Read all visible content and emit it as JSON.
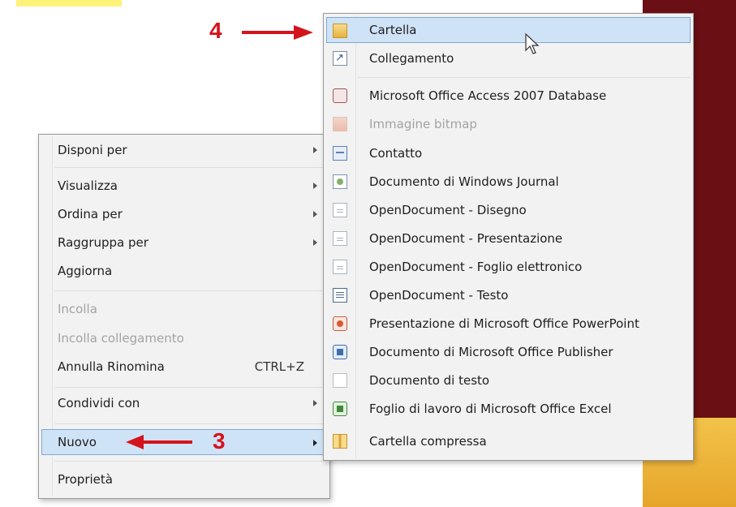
{
  "context_menu": {
    "items": [
      {
        "label": "Disponi per",
        "submenu": true
      },
      {
        "label": "Visualizza",
        "submenu": true
      },
      {
        "label": "Ordina per",
        "submenu": true
      },
      {
        "label": "Raggruppa per",
        "submenu": true
      },
      {
        "label": "Aggiorna"
      },
      {
        "label": "Incolla",
        "disabled": true
      },
      {
        "label": "Incolla collegamento",
        "disabled": true
      },
      {
        "label": "Annulla Rinomina",
        "shortcut": "CTRL+Z"
      },
      {
        "label": "Condividi con",
        "submenu": true
      },
      {
        "label": "Nuovo",
        "submenu": true,
        "highlighted": true
      },
      {
        "label": "Proprietà"
      }
    ]
  },
  "new_submenu": {
    "items": [
      {
        "label": "Cartella",
        "icon": "folder-icon",
        "highlighted": true
      },
      {
        "label": "Collegamento",
        "icon": "shortcut-icon"
      },
      {
        "label": "Microsoft Office Access 2007 Database",
        "icon": "access-icon"
      },
      {
        "label": "Immagine bitmap",
        "icon": "bitmap-icon",
        "disabled": true
      },
      {
        "label": "Contatto",
        "icon": "contact-icon"
      },
      {
        "label": "Documento di Windows Journal",
        "icon": "journal-icon"
      },
      {
        "label": "OpenDocument - Disegno",
        "icon": "document-icon"
      },
      {
        "label": "OpenDocument - Presentazione",
        "icon": "document-icon"
      },
      {
        "label": "OpenDocument - Foglio elettronico",
        "icon": "document-icon"
      },
      {
        "label": "OpenDocument - Testo",
        "icon": "text-document-icon"
      },
      {
        "label": "Presentazione di Microsoft Office PowerPoint",
        "icon": "powerpoint-icon"
      },
      {
        "label": "Documento di Microsoft Office Publisher",
        "icon": "publisher-icon"
      },
      {
        "label": "Documento di testo",
        "icon": "text-file-icon"
      },
      {
        "label": "Foglio di lavoro di Microsoft Office Excel",
        "icon": "excel-icon"
      },
      {
        "label": "Cartella compressa",
        "icon": "zip-folder-icon"
      }
    ]
  },
  "annotations": {
    "step_new": "3",
    "step_folder": "4",
    "color": "#d4141c"
  },
  "colors": {
    "highlight_fill": "#cfe3f6",
    "highlight_border": "#7fa9d6",
    "menu_background": "#f2f2f2"
  }
}
